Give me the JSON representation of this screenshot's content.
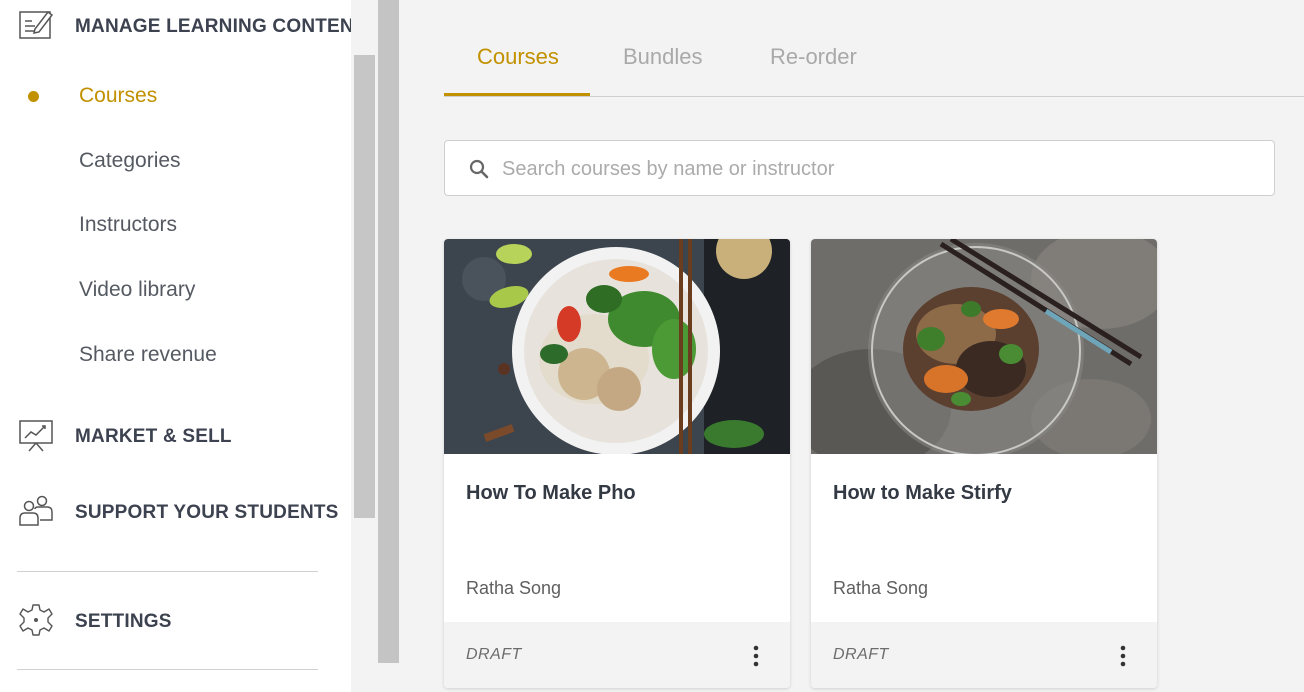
{
  "sidebar": {
    "sections": {
      "manage": {
        "label": "MANAGE LEARNING CONTENT",
        "icon": "edit-document-icon"
      },
      "market": {
        "label": "MARKET & SELL",
        "icon": "presentation-chart-icon"
      },
      "support": {
        "label": "SUPPORT YOUR STUDENTS",
        "icon": "people-icon"
      },
      "settings": {
        "label": "SETTINGS",
        "icon": "gear-icon"
      }
    },
    "items": [
      {
        "label": "Courses",
        "active": true
      },
      {
        "label": "Categories"
      },
      {
        "label": "Instructors"
      },
      {
        "label": "Video library"
      },
      {
        "label": "Share revenue"
      }
    ]
  },
  "tabs": [
    {
      "label": "Courses",
      "active": true
    },
    {
      "label": "Bundles"
    },
    {
      "label": "Re-order"
    }
  ],
  "search": {
    "placeholder": "Search courses by name or instructor",
    "value": ""
  },
  "courses": [
    {
      "title": "How To Make Pho",
      "instructor": "Ratha Song",
      "status": "DRAFT",
      "image": "pho-bowl-photo"
    },
    {
      "title": "How to Make Stirfy",
      "instructor": "Ratha Song",
      "status": "DRAFT",
      "image": "stirfry-plate-photo"
    }
  ],
  "colors": {
    "accent": "#c29100",
    "heading": "#3d4250",
    "muted_tab": "#a9a9a9"
  }
}
